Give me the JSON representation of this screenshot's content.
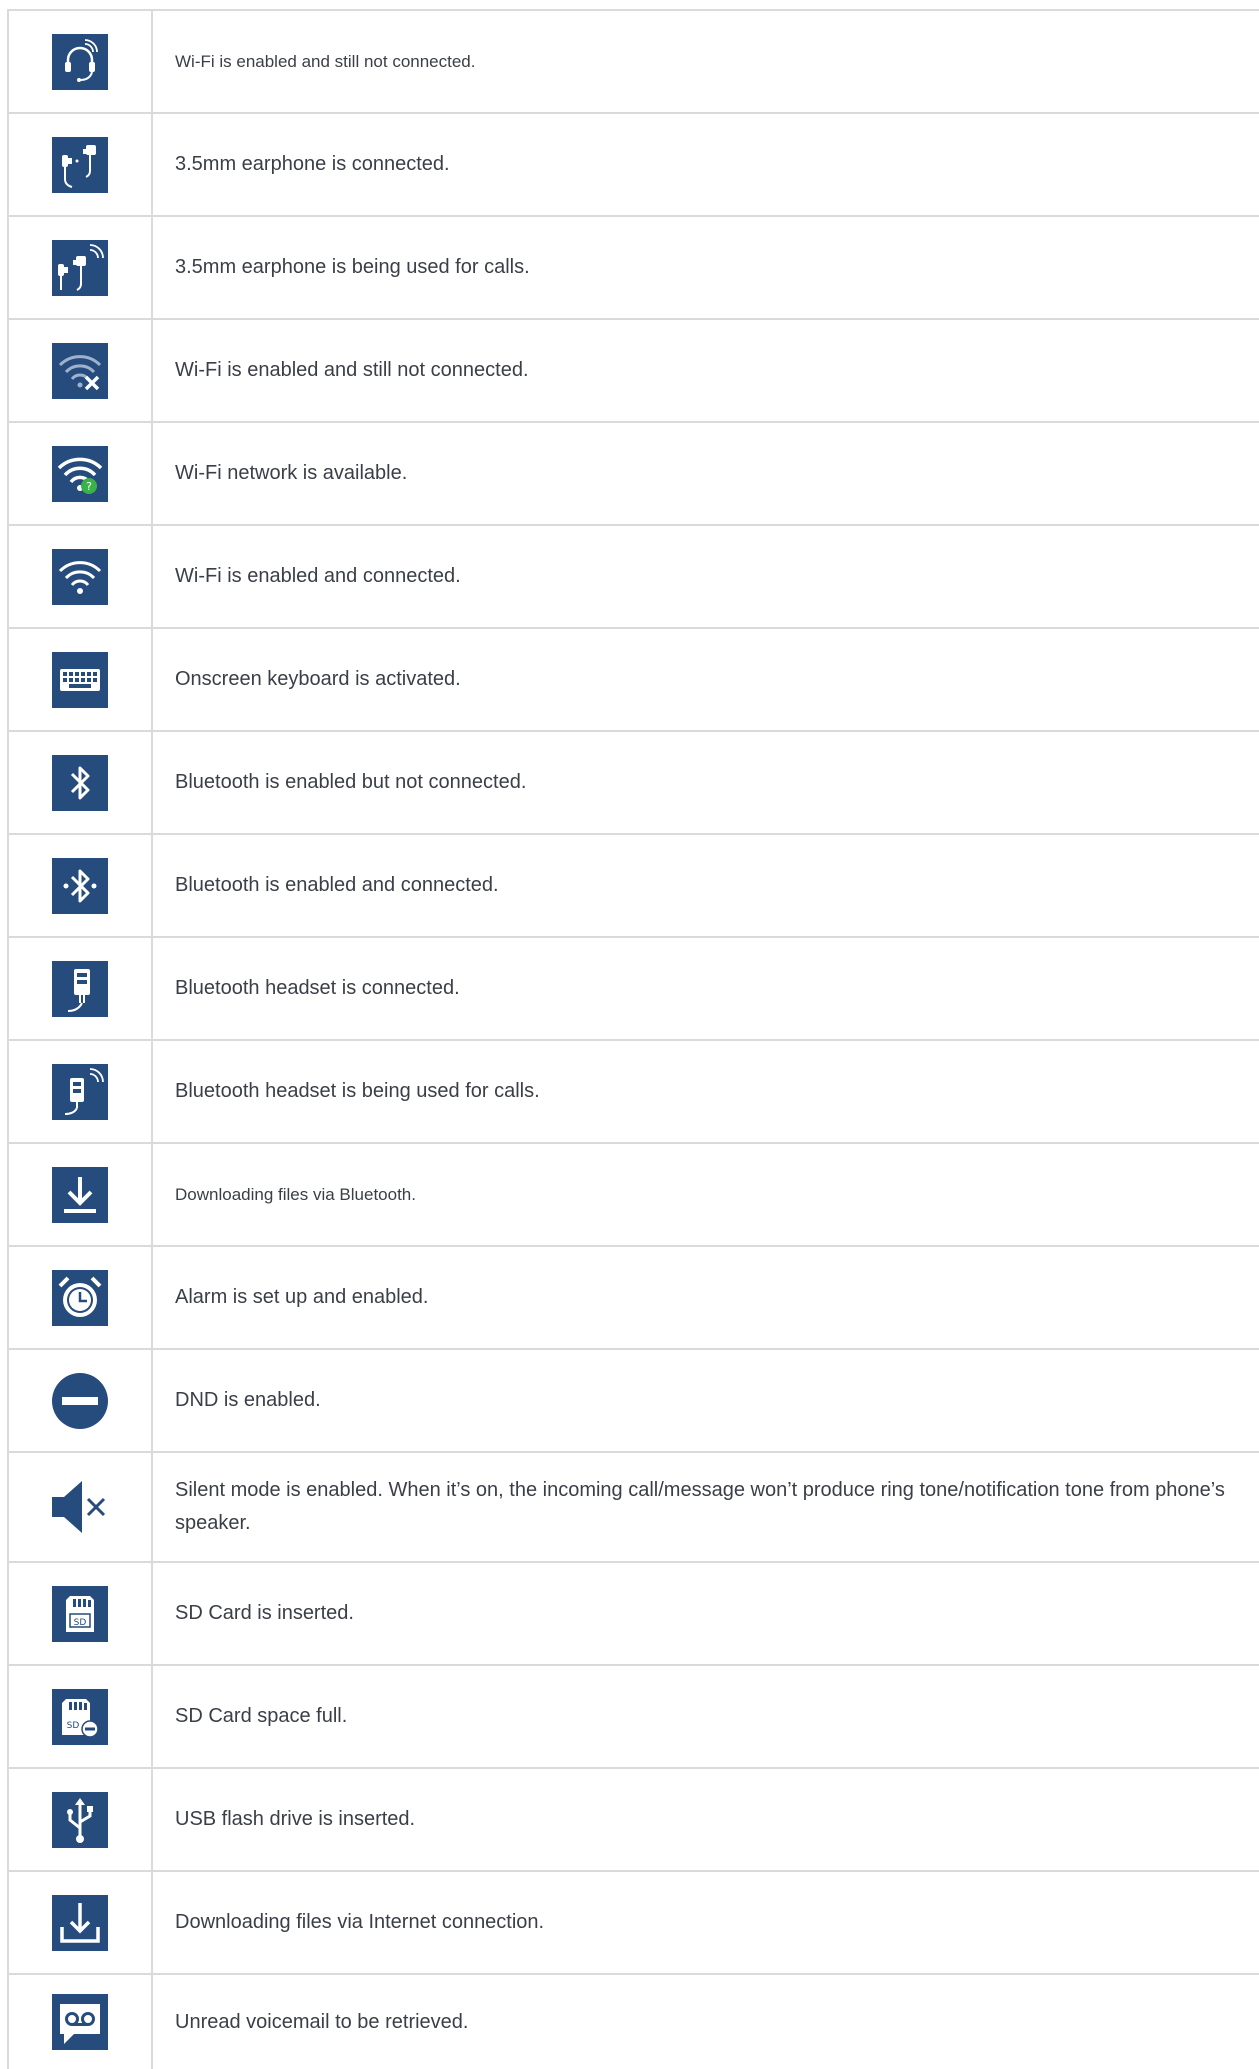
{
  "colors": {
    "icon_bg": "#264b7d",
    "icon_fg": "#ffffff",
    "border": "#d9dadc",
    "text": "#3a3f47",
    "accent_green": "#3bb14a"
  },
  "rows": [
    {
      "icon": "headset-wifi-icon",
      "text": "Wi-Fi is enabled and still not connected."
    },
    {
      "icon": "earphone-icon",
      "text": "3.5mm earphone is connected."
    },
    {
      "icon": "earphone-call-icon",
      "text": "3.5mm earphone is being used for calls."
    },
    {
      "icon": "wifi-disconnected-icon",
      "text": "Wi-Fi is enabled and still not connected."
    },
    {
      "icon": "wifi-available-icon",
      "text": "Wi-Fi network is available."
    },
    {
      "icon": "wifi-connected-icon",
      "text": "Wi-Fi is enabled and connected."
    },
    {
      "icon": "keyboard-icon",
      "text": "Onscreen keyboard is activated."
    },
    {
      "icon": "bluetooth-icon",
      "text": "Bluetooth is enabled but not connected."
    },
    {
      "icon": "bluetooth-connected-icon",
      "text": "Bluetooth is enabled and connected."
    },
    {
      "icon": "bluetooth-headset-icon",
      "text": "Bluetooth headset is connected."
    },
    {
      "icon": "bluetooth-headset-call-icon",
      "text": "Bluetooth headset is being used for calls."
    },
    {
      "icon": "download-icon",
      "text": "Downloading files via Bluetooth."
    },
    {
      "icon": "alarm-icon",
      "text": "Alarm is set up and enabled."
    },
    {
      "icon": "dnd-icon",
      "text": "DND is enabled."
    },
    {
      "icon": "silent-icon",
      "text": "Silent mode is enabled. When it’s on, the incoming call/message won’t produce ring tone/notification tone from phone’s speaker."
    },
    {
      "icon": "sd-card-icon",
      "text": "SD Card is inserted."
    },
    {
      "icon": "sd-card-full-icon",
      "text": "SD Card space full."
    },
    {
      "icon": "usb-icon",
      "text": "USB flash drive is inserted."
    },
    {
      "icon": "internet-download-icon",
      "text": "Downloading files via Internet connection."
    },
    {
      "icon": "voicemail-icon",
      "text": "Unread voicemail to be retrieved."
    }
  ]
}
